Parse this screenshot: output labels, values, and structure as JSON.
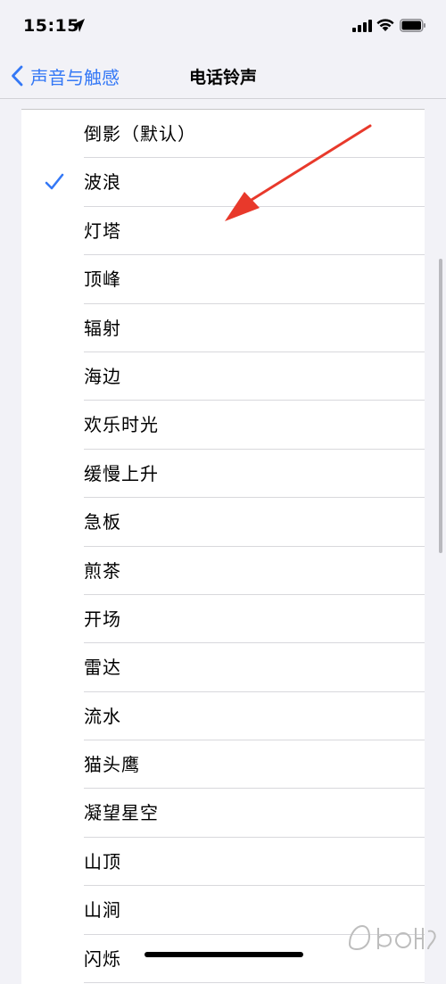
{
  "status_bar": {
    "time": "15:15"
  },
  "nav": {
    "back_label": "声音与触感",
    "title": "电话铃声"
  },
  "ringtones": [
    {
      "name": "倒影（默认）",
      "selected": false
    },
    {
      "name": "波浪",
      "selected": true
    },
    {
      "name": "灯塔",
      "selected": false
    },
    {
      "name": "顶峰",
      "selected": false
    },
    {
      "name": "辐射",
      "selected": false
    },
    {
      "name": "海边",
      "selected": false
    },
    {
      "name": "欢乐时光",
      "selected": false
    },
    {
      "name": "缓慢上升",
      "selected": false
    },
    {
      "name": "急板",
      "selected": false
    },
    {
      "name": "煎茶",
      "selected": false
    },
    {
      "name": "开场",
      "selected": false
    },
    {
      "name": "雷达",
      "selected": false
    },
    {
      "name": "流水",
      "selected": false
    },
    {
      "name": "猫头鹰",
      "selected": false
    },
    {
      "name": "凝望星空",
      "selected": false
    },
    {
      "name": "山顶",
      "selected": false
    },
    {
      "name": "山涧",
      "selected": false
    },
    {
      "name": "闪烁",
      "selected": false
    }
  ],
  "colors": {
    "accent": "#3478f6",
    "annotation": "#e8392b"
  },
  "icons": {
    "back": "chevron-left-icon",
    "check": "checkmark-icon",
    "location": "location-arrow-icon",
    "signal": "cellular-signal-icon",
    "wifi": "wifi-icon",
    "battery": "battery-icon"
  }
}
